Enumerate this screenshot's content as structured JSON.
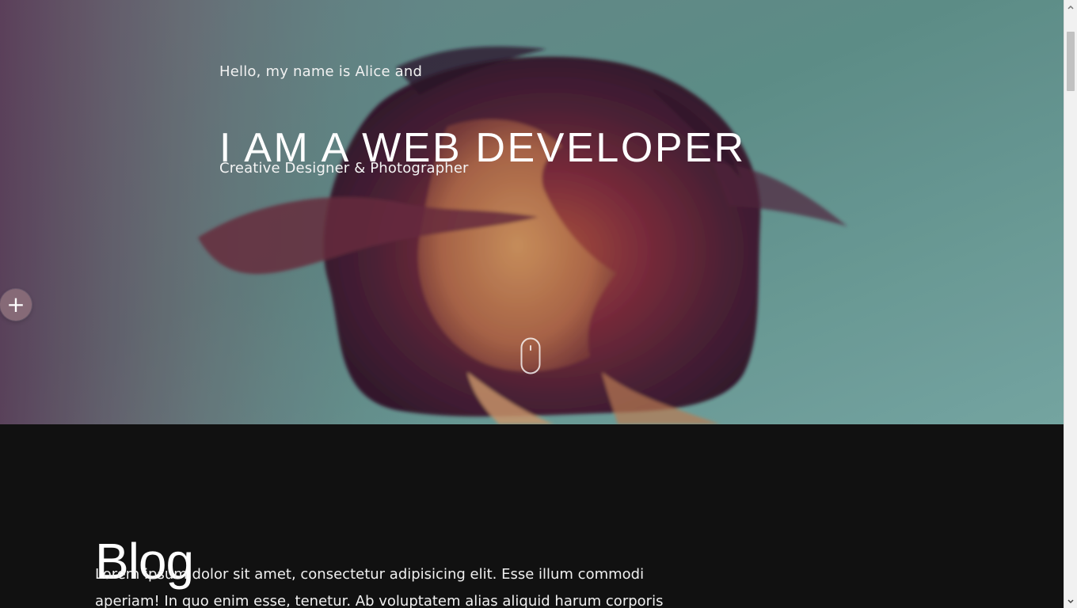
{
  "hero": {
    "intro": "Hello, my name is Alice and",
    "headline": "I AM A WEB DEVELOPER",
    "subtitle": "Creative Designer & Photographer"
  },
  "controls": {
    "side_toggle_symbol": "+",
    "side_toggle_icon": "plus-icon",
    "scroll_indicator_icon": "mouse-scroll-icon",
    "scrollbar_up_icon": "chevron-up-icon",
    "scrollbar_down_icon": "chevron-down-icon"
  },
  "blog": {
    "title": "Blog",
    "paragraph": "Lorem ipsum dolor sit amet, consectetur adipisicing elit. Esse illum commodi aperiam! In quo enim esse, tenetur. Ab voluptatem alias aliquid harum corporis"
  },
  "colors": {
    "hero_background": "#5f9790",
    "hero_overlay": "#4b2e56",
    "blog_background": "#111111",
    "text": "#ffffff"
  }
}
